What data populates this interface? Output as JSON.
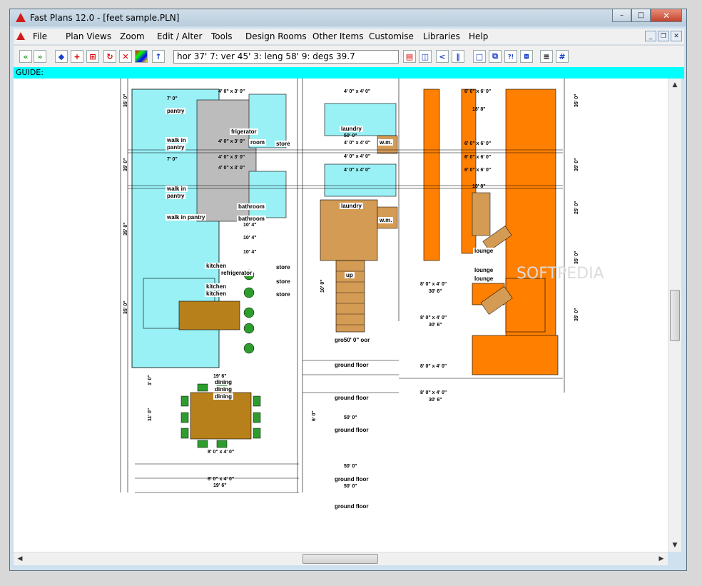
{
  "window": {
    "title": "Fast Plans 12.0 - [feet sample.PLN]",
    "controls": {
      "minimize": "–",
      "maximize": "□",
      "close": "✕"
    },
    "mdi_controls": {
      "minimize": "_",
      "restore": "❐",
      "close": "✕"
    }
  },
  "menu": [
    "File",
    "Plan Views",
    "Zoom",
    "Edit / Alter",
    "Tools",
    "Design Rooms",
    "Other Items",
    "Customise",
    "Libraries",
    "Help"
  ],
  "toolbar": {
    "coordinates": "hor 37' 7: ver 45' 3: leng 58' 9: degs 39.7"
  },
  "guide": {
    "label": "GUIDE:"
  },
  "plan": {
    "rooms": {
      "walk_in_pantry": "walk in pantry",
      "walk_in": "walk in",
      "pantry": "pantry",
      "refrigerator": "refrigerator",
      "frigerator": "frigerator",
      "room": "room",
      "store": "store",
      "laundry": "laundry",
      "wm": "w.m.",
      "bathroom": "bathroom",
      "kitchen": "kitchen",
      "dining": "dining",
      "up": "up",
      "ground_floor": "ground floor",
      "gro_floor": "gro50' 0\" oor",
      "lounge": "lounge"
    },
    "dims": {
      "d7_0": "7' 0\"",
      "d4x3": "4' 0\" x 3' 0\"",
      "d50": "50' 0\"",
      "d4x4": "4' 0\" x 4' 0\"",
      "d6x6": "6' 0\" x 6' 0\"",
      "d18_8": "18' 8\"",
      "d10_4": "10' 4\"",
      "d8x4": "8' 0\" x 4' 0\"",
      "d30_6": "30' 6\"",
      "d19_6": "19' 6\"",
      "d35": "35' 0\"",
      "d25": "25' 0\"",
      "d11": "11' 0\"",
      "d10": "10' 0\"",
      "d6": "6' 0\"",
      "d1": "1' 0\""
    },
    "watermark": "SOFTPEDIA"
  },
  "colors": {
    "cyan": "#99f0f5",
    "orange": "#ff7f00",
    "tan": "#d49b55",
    "brown": "#b8801a",
    "green": "#2d9d2d",
    "gray": "#bcbcbc"
  }
}
